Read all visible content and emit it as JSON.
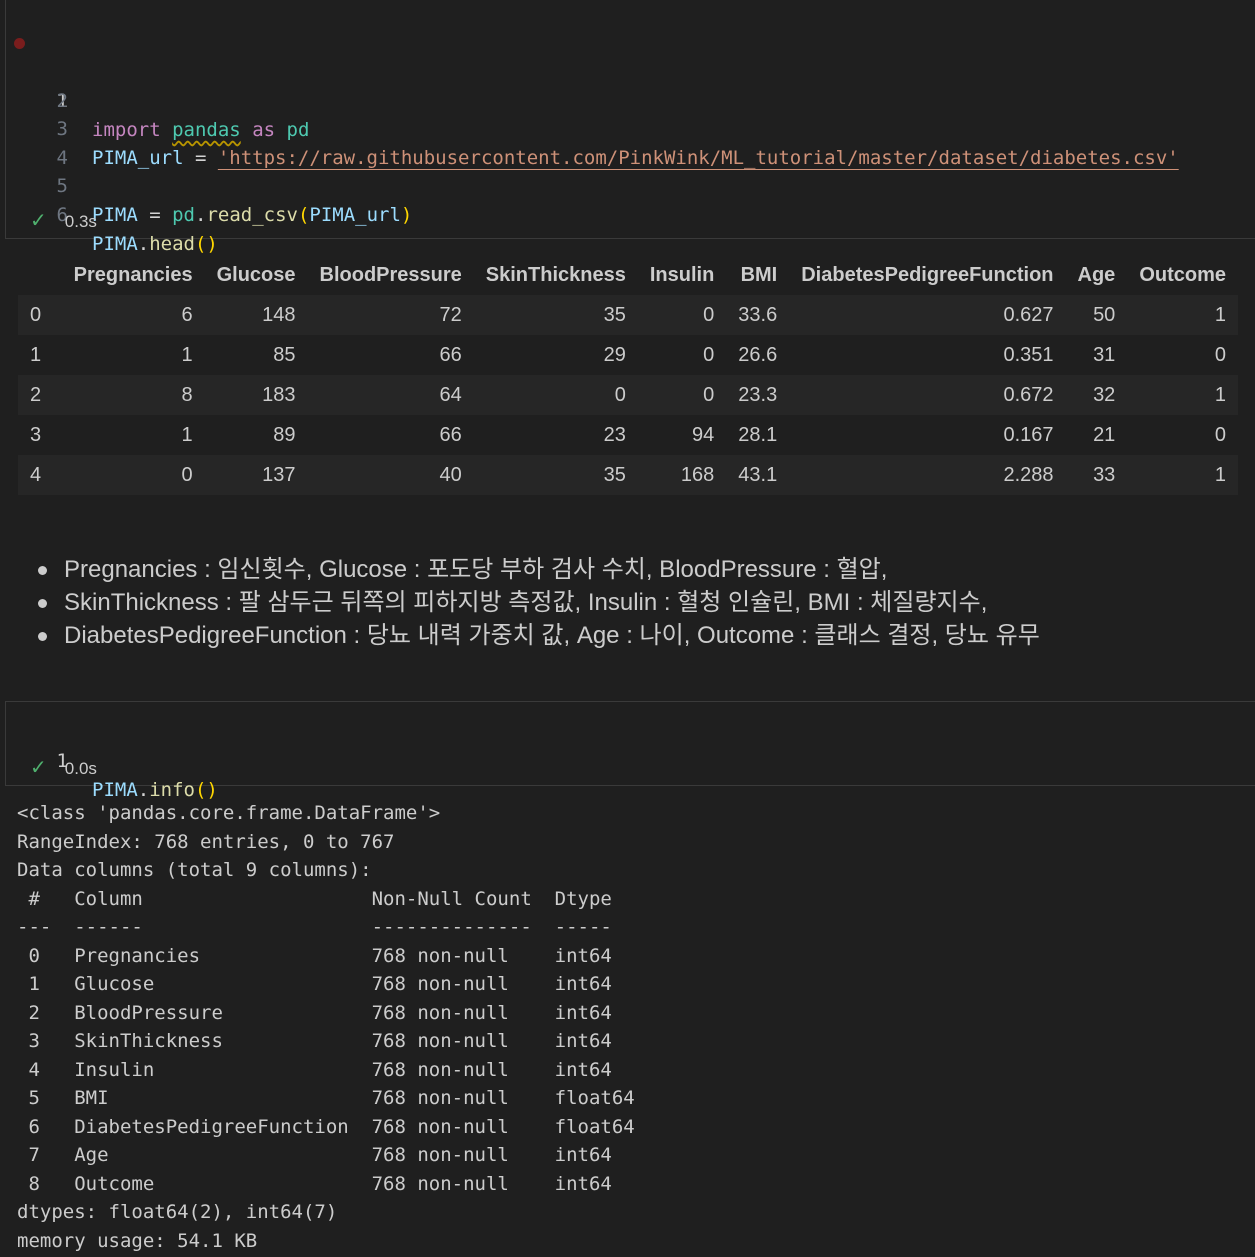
{
  "cell1": {
    "lines": [
      {
        "num": "1"
      },
      {
        "num": "2"
      },
      {
        "num": "3"
      },
      {
        "num": "4"
      },
      {
        "num": "5"
      },
      {
        "num": "6"
      }
    ],
    "tokens": {
      "import": "import",
      "pandas": "pandas",
      "as": "as",
      "pd": "pd",
      "pima_url": "PIMA_url",
      "eq": " = ",
      "url_string": "'https://raw.githubusercontent.com/PinkWink/ML_tutorial/master/dataset/diabetes.csv'",
      "pima": "PIMA",
      "pd2": "pd",
      "dot": ".",
      "read_csv": "read_csv",
      "lparen": "(",
      "rparen": ")",
      "head": "head",
      "empty_parens": "()"
    },
    "exec_time": "0.3s"
  },
  "dataframe": {
    "columns": [
      "",
      "Pregnancies",
      "Glucose",
      "BloodPressure",
      "SkinThickness",
      "Insulin",
      "BMI",
      "DiabetesPedigreeFunction",
      "Age",
      "Outcome"
    ],
    "rows": [
      [
        "0",
        "6",
        "148",
        "72",
        "35",
        "0",
        "33.6",
        "0.627",
        "50",
        "1"
      ],
      [
        "1",
        "1",
        "85",
        "66",
        "29",
        "0",
        "26.6",
        "0.351",
        "31",
        "0"
      ],
      [
        "2",
        "8",
        "183",
        "64",
        "0",
        "0",
        "23.3",
        "0.672",
        "32",
        "1"
      ],
      [
        "3",
        "1",
        "89",
        "66",
        "23",
        "94",
        "28.1",
        "0.167",
        "21",
        "0"
      ],
      [
        "4",
        "0",
        "137",
        "40",
        "35",
        "168",
        "43.1",
        "2.288",
        "33",
        "1"
      ]
    ]
  },
  "notes": [
    "Pregnancies : 임신횟수, Glucose : 포도당 부하 검사 수치, BloodPressure : 혈압,",
    "SkinThickness : 팔 삼두근 뒤쪽의 피하지방 측정값, Insulin : 혈청 인슐린, BMI : 체질량지수,",
    "DiabetesPedigreeFunction : 당뇨 내력 가중치 값, Age : 나이, Outcome : 클래스 결정, 당뇨 유무"
  ],
  "cell2": {
    "line_num": "1",
    "tokens": {
      "pima": "PIMA",
      "dot": ".",
      "info": "info",
      "parens": "()"
    },
    "exec_time": "0.0s"
  },
  "info_output": {
    "lines": [
      "<class 'pandas.core.frame.DataFrame'>",
      "RangeIndex: 768 entries, 0 to 767",
      "Data columns (total 9 columns):",
      " #   Column                    Non-Null Count  Dtype  ",
      "---  ------                    --------------  -----  ",
      " 0   Pregnancies               768 non-null    int64  ",
      " 1   Glucose                   768 non-null    int64  ",
      " 2   BloodPressure             768 non-null    int64  ",
      " 3   SkinThickness             768 non-null    int64  ",
      " 4   Insulin                   768 non-null    int64  ",
      " 5   BMI                       768 non-null    float64",
      " 6   DiabetesPedigreeFunction  768 non-null    float64",
      " 7   Age                       768 non-null    int64  ",
      " 8   Outcome                   768 non-null    int64  ",
      "dtypes: float64(2), int64(7)",
      "memory usage: 54.1 KB"
    ]
  },
  "colors": {
    "background": "#1f1f1f",
    "keyword": "#c586c0",
    "module": "#4ec9b0",
    "variable": "#9cdcfe",
    "function": "#dcdcaa",
    "string": "#ce9178",
    "success": "#4fb06e"
  },
  "icons": [
    "breakpoint-icon",
    "check-icon"
  ]
}
